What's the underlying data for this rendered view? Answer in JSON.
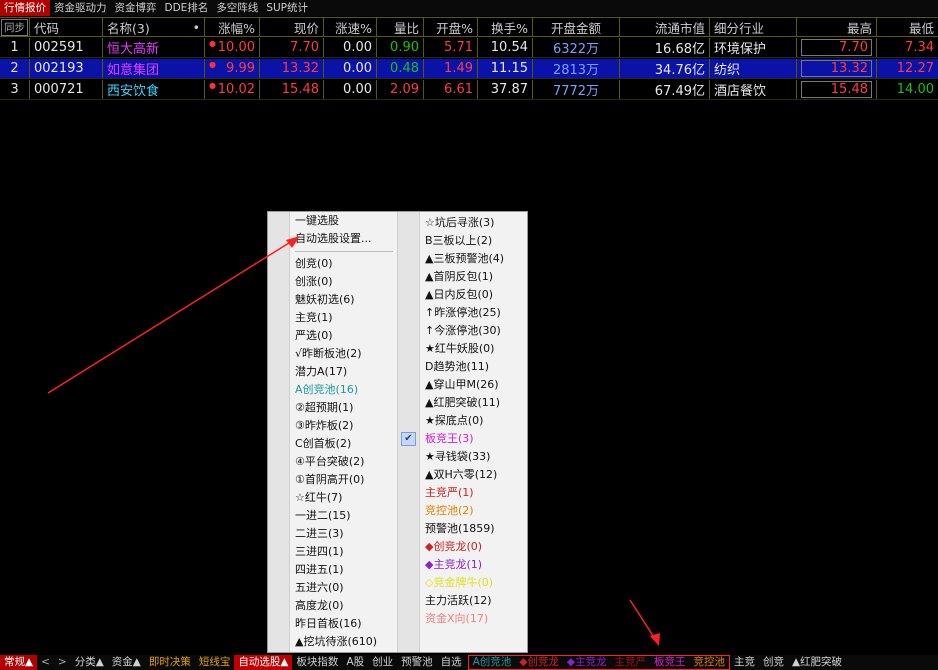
{
  "top_tabs": [
    "行情报价",
    "资金驱动力",
    "资金博弈",
    "DDE排名",
    "多空阵线",
    "SUP统计"
  ],
  "header": {
    "sync": "同步",
    "code": "代码",
    "name": "名称(3)",
    "dot": "•",
    "change_pct": "涨幅%",
    "price": "现价",
    "speed": "涨速%",
    "vol_ratio": "量比",
    "open_pct": "开盘%",
    "turnover": "换手%",
    "open_amount": "开盘金额",
    "float_mcap": "流通市值",
    "industry": "细分行业",
    "high": "最高",
    "low": "最低"
  },
  "rows": [
    {
      "idx": "1",
      "code": "002591",
      "name": "恒大高新",
      "change_pct": "10.00",
      "price": "7.70",
      "speed": "0.00",
      "vol_ratio": "0.90",
      "open_pct": "5.71",
      "turnover": "10.54",
      "open_amount": "6322万",
      "float_mcap": "16.68亿",
      "industry": "环境保护",
      "high": "7.70",
      "low": "7.34"
    },
    {
      "idx": "2",
      "code": "002193",
      "name": "如意集团",
      "change_pct": "9.99",
      "price": "13.32",
      "speed": "0.00",
      "vol_ratio": "0.48",
      "open_pct": "1.49",
      "turnover": "11.15",
      "open_amount": "2813万",
      "float_mcap": "34.76亿",
      "industry": "纺织",
      "high": "13.32",
      "low": "12.27"
    },
    {
      "idx": "3",
      "code": "000721",
      "name": "西安饮食",
      "change_pct": "10.02",
      "price": "15.48",
      "speed": "0.00",
      "vol_ratio": "2.09",
      "open_pct": "6.61",
      "turnover": "37.87",
      "open_amount": "7772万",
      "float_mcap": "67.49亿",
      "industry": "酒店餐饮",
      "high": "15.48",
      "low": "14.00"
    }
  ],
  "menu": {
    "left_top": [
      "一键选股",
      "自动选股设置..."
    ],
    "left": [
      {
        "label": "创竞(0)",
        "color": "#111111"
      },
      {
        "label": "创涨(0)",
        "color": "#111111"
      },
      {
        "label": "魅妖初选(6)",
        "color": "#111111"
      },
      {
        "label": "主竞(1)",
        "color": "#111111"
      },
      {
        "label": "严选(0)",
        "color": "#111111"
      },
      {
        "label": "√昨断板池(2)",
        "color": "#111111"
      },
      {
        "label": "潜力A(17)",
        "color": "#111111"
      },
      {
        "label": "A创竞池(16)",
        "color": "#1a9a9a"
      },
      {
        "label": "②超预期(1)",
        "color": "#111111"
      },
      {
        "label": "③昨炸板(2)",
        "color": "#111111"
      },
      {
        "label": "C创首板(2)",
        "color": "#111111"
      },
      {
        "label": "④平台突破(2)",
        "color": "#111111"
      },
      {
        "label": "①首阴高开(0)",
        "color": "#111111"
      },
      {
        "label": "☆红牛(7)",
        "color": "#111111"
      },
      {
        "label": "一进二(15)",
        "color": "#111111"
      },
      {
        "label": "二进三(3)",
        "color": "#111111"
      },
      {
        "label": "三进四(1)",
        "color": "#111111"
      },
      {
        "label": "四进五(1)",
        "color": "#111111"
      },
      {
        "label": "五进六(0)",
        "color": "#111111"
      },
      {
        "label": "高度龙(0)",
        "color": "#111111"
      },
      {
        "label": "昨日首板(16)",
        "color": "#111111"
      },
      {
        "label": "▲挖坑待涨(610)",
        "color": "#111111"
      }
    ],
    "right": [
      {
        "label": "☆坑后寻涨(3)",
        "color": "#111111"
      },
      {
        "label": "B三板以上(2)",
        "color": "#111111"
      },
      {
        "label": "▲三板预警池(4)",
        "color": "#111111"
      },
      {
        "label": "▲首阴反包(1)",
        "color": "#111111"
      },
      {
        "label": "▲日内反包(0)",
        "color": "#111111"
      },
      {
        "label": "↑昨涨停池(25)",
        "color": "#111111"
      },
      {
        "label": "↑今涨停池(30)",
        "color": "#111111"
      },
      {
        "label": "★红牛妖股(0)",
        "color": "#111111"
      },
      {
        "label": "D趋势池(11)",
        "color": "#111111"
      },
      {
        "label": "▲穿山甲M(26)",
        "color": "#111111"
      },
      {
        "label": "▲红肥突破(11)",
        "color": "#111111"
      },
      {
        "label": "★探底点(0)",
        "color": "#111111"
      },
      {
        "label": "板竞王(3)",
        "color": "#d020d0",
        "checked": true
      },
      {
        "label": "★寻钱袋(33)",
        "color": "#111111"
      },
      {
        "label": "▲双H六零(12)",
        "color": "#111111"
      },
      {
        "label": "主竞严(1)",
        "color": "#d02020"
      },
      {
        "label": "竞控池(2)",
        "color": "#e08000"
      },
      {
        "label": "预警池(1859)",
        "color": "#111111"
      },
      {
        "label": "◆创竞龙(0)",
        "color": "#d02020"
      },
      {
        "label": "◆主竞龙(1)",
        "color": "#8a20d0"
      },
      {
        "label": "◇竞金牌牛(0)",
        "color": "#e0e020"
      },
      {
        "label": "主力活跃(12)",
        "color": "#111111"
      },
      {
        "label": "资金X向(17)",
        "color": "#f08080"
      }
    ]
  },
  "bottom_tabs": [
    "常规▲",
    "<",
    ">",
    "分类▲",
    "资金▲",
    "即时决策",
    "短线宝",
    "自动选股▲",
    "板块指数",
    "A股",
    "创业",
    "预警池",
    "自选"
  ],
  "bottom_box": [
    "A创竞池",
    "◆创竞龙",
    "◆主竞龙",
    "主竞严",
    "板竞王",
    "竞控池"
  ],
  "bottom_tail": [
    "主竞",
    "创竞",
    "▲红肥突破"
  ],
  "colors": {
    "selected_row": "#0b12a8",
    "up": "#ff3c3c",
    "down": "#16c216",
    "grid": "#5a5a00",
    "arrow": "#ff2020"
  }
}
